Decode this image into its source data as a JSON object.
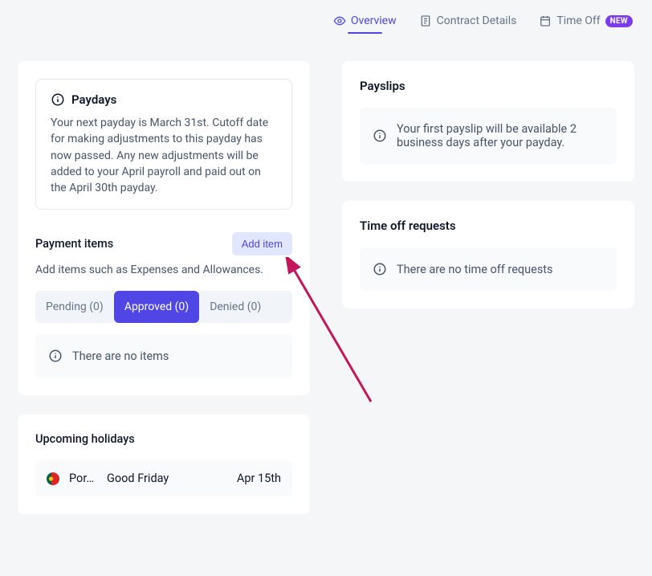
{
  "tabs": {
    "overview": "Overview",
    "contract": "Contract Details",
    "timeoff": "Time Off",
    "new_badge": "NEW"
  },
  "paydays": {
    "title": "Paydays",
    "body": "Your next payday is March 31st. Cutoff date for making adjustments to this payday has now passed. Any new adjustments will be added to your April payroll and paid out on the April 30th payday."
  },
  "payment_items": {
    "title": "Payment items",
    "add_button": "Add item",
    "subtitle": "Add items such as Expenses and Allowances.",
    "tabs": {
      "pending": "Pending (0)",
      "approved": "Approved (0)",
      "denied": "Denied (0)"
    },
    "empty": "There are no items"
  },
  "holidays": {
    "title": "Upcoming holidays",
    "items": [
      {
        "country": "Por…",
        "name": "Good Friday",
        "date": "Apr 15th"
      }
    ]
  },
  "payslips": {
    "title": "Payslips",
    "empty": "Your first payslip will be available 2 business days after your payday."
  },
  "timeoff_requests": {
    "title": "Time off requests",
    "empty": "There are no time off requests"
  }
}
